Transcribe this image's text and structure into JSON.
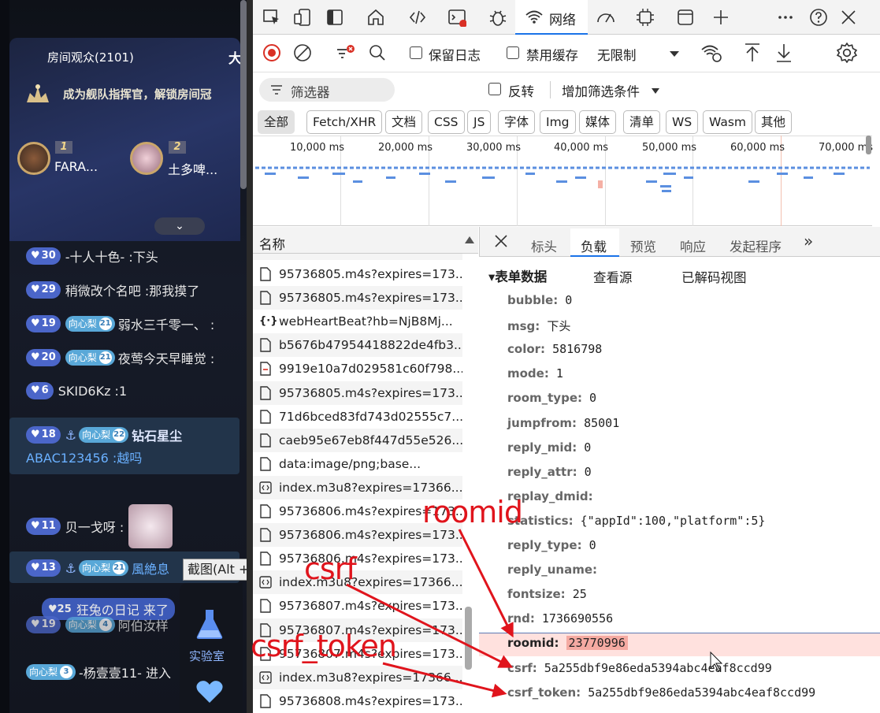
{
  "live": {
    "audience": "房间观众(2101)",
    "header_char": "大",
    "promo": "成为舰队指挥官，解锁房间冠",
    "ranks": [
      {
        "no": "1",
        "name": "FARA..."
      },
      {
        "no": "2",
        "name": "土多啤..."
      }
    ],
    "expand_icon": "chevron-down-icon",
    "chat": [
      {
        "level": "30",
        "text": "-十人十色- :下头"
      },
      {
        "level": "29",
        "text": "稍微改个名吧 :那我摸了"
      },
      {
        "level": "19",
        "fan": "向心梨",
        "fan_level": "21",
        "text": "弱水三千零一、 :"
      },
      {
        "level": "20",
        "fan": "向心梨",
        "fan_level": "21",
        "text": "夜莺今天早睡觉 :"
      },
      {
        "level": "6",
        "text": "SKID6Kz :1"
      },
      {
        "level": "18",
        "fan": "向心梨",
        "fan_level": "22",
        "text": "钻石星尘",
        "line2": "ABAC123456 :越吗"
      },
      {
        "level": "11",
        "text": "贝一戈呀 :"
      },
      {
        "level": "13",
        "fan": "向心梨",
        "fan_level": "21",
        "text": "風絶息"
      },
      {
        "level": "25",
        "text": "狂兔の日记 来了"
      },
      {
        "level": "19",
        "fan": "向心梨",
        "fan_level": "4",
        "text": "阿伯汝样"
      },
      {
        "fan": "向心梨",
        "fan_level": "3",
        "text": "-杨壹壹11- 进入"
      }
    ],
    "tooltip": "截图(Alt + A)",
    "lab_label": "实验室"
  },
  "devtools": {
    "network_tab": "网络",
    "preserve_log": "保留日志",
    "disable_cache": "禁用缓存",
    "throttle": "无限制",
    "filter_placeholder": "筛选器",
    "invert": "反转",
    "more_filters": "增加筛选条件",
    "types": [
      "全部",
      "Fetch/XHR",
      "文档",
      "CSS",
      "JS",
      "字体",
      "Img",
      "媒体",
      "清单",
      "WS",
      "Wasm",
      "其他"
    ],
    "timeline_ticks": [
      "10,000 ms",
      "20,000 ms",
      "30,000 ms",
      "40,000 ms",
      "50,000 ms",
      "60,000 ms",
      "70,000 ms"
    ],
    "list_header": "名称",
    "requests": [
      "95736805.m4s?expires=173...",
      "95736805.m4s?expires=173...",
      "webHeartBeat?hb=NjB8Mj...",
      "b5676b47954418822de4fb3...",
      "9919e10a7d029581c60f798...",
      "95736805.m4s?expires=173...",
      "71d6bced83fd743d02555c7...",
      "caeb95e67eb8f447d55e526...",
      "data:image/png;base...",
      "index.m3u8?expires=17366...",
      "95736806.m4s?expires=173...",
      "95736806.m4s?expires=173...",
      "95736806.m4s?expires=173...",
      "index.m3u8?expires=17366...",
      "95736807.m4s?expires=173...",
      "95736807.m4s?expires=173...",
      "95736807.m4s?expires=173...",
      "index.m3u8?expires=17366...",
      "95736808.m4s?expires=173..."
    ],
    "detail_tabs": [
      "标头",
      "负载",
      "预览",
      "响应",
      "发起程序"
    ],
    "section_title": "▾表单数据",
    "view_source": "查看源",
    "view_decoded": "已解码视图",
    "form": [
      {
        "k": "bubble:",
        "v": "0"
      },
      {
        "k": "msg:",
        "v": "下头"
      },
      {
        "k": "color:",
        "v": "5816798"
      },
      {
        "k": "mode:",
        "v": "1"
      },
      {
        "k": "room_type:",
        "v": "0"
      },
      {
        "k": "jumpfrom:",
        "v": "85001"
      },
      {
        "k": "reply_mid:",
        "v": "0"
      },
      {
        "k": "reply_attr:",
        "v": "0"
      },
      {
        "k": "replay_dmid:",
        "v": ""
      },
      {
        "k": "statistics:",
        "v": "{\"appId\":100,\"platform\":5}"
      },
      {
        "k": "reply_type:",
        "v": "0"
      },
      {
        "k": "reply_uname:",
        "v": ""
      },
      {
        "k": "fontsize:",
        "v": "25"
      },
      {
        "k": "rnd:",
        "v": "1736690556"
      },
      {
        "k": "roomid:",
        "v": "23770996"
      },
      {
        "k": "csrf:",
        "v": "5a255dbf9e86eda5394abc4eaf8ccd99"
      },
      {
        "k": "csrf_token:",
        "v": "5a255dbf9e86eda5394abc4eaf8ccd99"
      }
    ],
    "annotations": {
      "roomid": "roomid",
      "csrf": "csrf",
      "csrf_token": "csrf_token"
    },
    "colors": {
      "accent": "#1a73e8",
      "record": "#d93025",
      "annotation": "#e0141c"
    }
  }
}
